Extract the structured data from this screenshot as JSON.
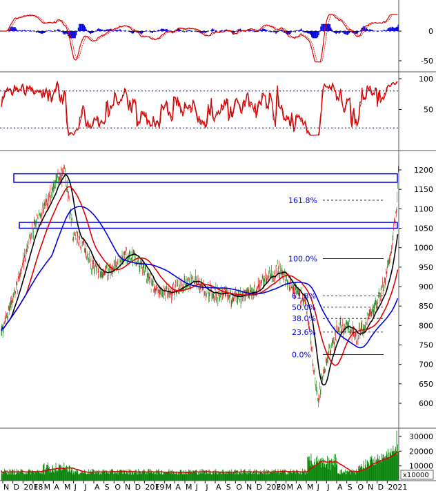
{
  "chart_data": [
    {
      "panel": "macd",
      "type": "line",
      "ylim": [
        -55,
        30
      ],
      "y_ticks": [
        0,
        -50
      ],
      "series": [],
      "histogram": "blue-bars-around-zero"
    },
    {
      "panel": "stochastic",
      "type": "line",
      "ylim": [
        0,
        100
      ],
      "y_ticks": [
        100,
        50
      ],
      "reference_lines": [
        80,
        20
      ],
      "series": []
    },
    {
      "panel": "price",
      "type": "candlestick",
      "ylim": [
        560,
        1210
      ],
      "y_ticks": [
        1200,
        1150,
        1100,
        1050,
        1000,
        950,
        900,
        850,
        800,
        750,
        700,
        650,
        600
      ],
      "x_ticks": [
        "N",
        "D",
        "2018",
        "F",
        "M",
        "A",
        "M",
        "J",
        "J",
        "A",
        "S",
        "O",
        "N",
        "D",
        "2019",
        "F",
        "M",
        "A",
        "M",
        "J",
        "J",
        "A",
        "S",
        "O",
        "N",
        "D",
        "2020",
        "F",
        "M",
        "A",
        "M",
        "J",
        "J",
        "A",
        "S",
        "O",
        "N",
        "D",
        "2021"
      ],
      "fibonacci": [
        {
          "label": "161.8%",
          "value": 1122
        },
        {
          "label": "100.0%",
          "value": 972
        },
        {
          "label": "61.8%",
          "value": 876
        },
        {
          "label": "50.0%",
          "value": 847
        },
        {
          "label": "38.0%",
          "value": 818
        },
        {
          "label": "23.6%",
          "value": 783
        },
        {
          "label": "0.0%",
          "value": 725
        }
      ],
      "resistance_boxes": [
        {
          "low": 1168,
          "high": 1190
        },
        {
          "low": 1050,
          "high": 1065
        }
      ],
      "moving_averages": [
        {
          "color": "#000000"
        },
        {
          "color": "#e00000"
        },
        {
          "color": "#0000e0"
        }
      ],
      "series": []
    },
    {
      "panel": "volume",
      "type": "bar",
      "ylim": [
        0,
        35000
      ],
      "y_ticks": [
        30000,
        20000,
        10000
      ],
      "unit": "x10000",
      "series": []
    }
  ],
  "colors": {
    "up": "#008000",
    "down": "#e00000",
    "ma_fast": "#000000",
    "ma_mid": "#e00000",
    "ma_slow": "#0000e0",
    "macd_hist": "#0000e0",
    "fib_label": "#0000e0",
    "volume_fill": "#008000",
    "box": "#0000e0"
  }
}
